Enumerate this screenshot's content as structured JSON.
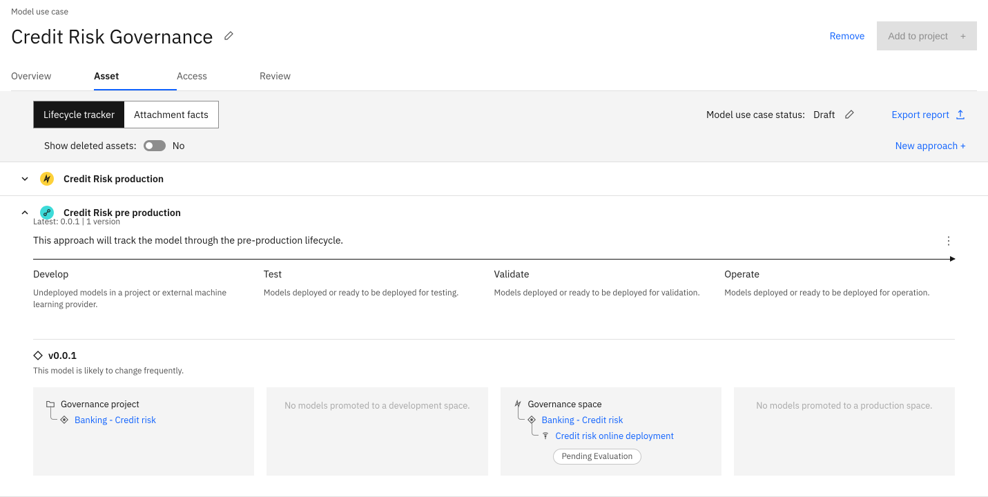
{
  "breadcrumb": "Model use case",
  "title": "Credit Risk Governance",
  "header_actions": {
    "remove": "Remove",
    "add_project": "Add to project"
  },
  "tabs": {
    "overview": "Overview",
    "asset": "Asset",
    "access": "Access",
    "review": "Review"
  },
  "segments": {
    "lifecycle": "Lifecycle tracker",
    "attachment": "Attachment facts"
  },
  "status": {
    "label": "Model use case status:",
    "value": "Draft"
  },
  "export_label": "Export report",
  "show_deleted": {
    "label": "Show deleted assets:",
    "value": "No"
  },
  "new_approach": "New approach +",
  "approaches": [
    {
      "name": "Credit Risk production"
    },
    {
      "name": "Credit Risk pre production",
      "latest": "Latest: 0.0.1 | 1 version",
      "description": "This approach will track the model through the pre-production lifecycle."
    }
  ],
  "stages": [
    {
      "title": "Develop",
      "desc": "Undeployed models in a project or external machine learning provider."
    },
    {
      "title": "Test",
      "desc": "Models deployed or ready to be deployed for testing."
    },
    {
      "title": "Validate",
      "desc": "Models deployed or ready to be deployed for validation."
    },
    {
      "title": "Operate",
      "desc": "Models deployed or ready to be deployed for operation."
    }
  ],
  "version": {
    "label": "v0.0.1",
    "note": "This model is likely to change frequently."
  },
  "cards": {
    "develop": {
      "project": "Governance project",
      "model": "Banking - Credit risk"
    },
    "test_empty": "No models promoted to a development space.",
    "validate": {
      "space": "Governance space",
      "model": "Banking - Credit risk",
      "deployment": "Credit risk online deployment",
      "badge": "Pending Evaluation"
    },
    "operate_empty": "No models promoted to a production space."
  }
}
